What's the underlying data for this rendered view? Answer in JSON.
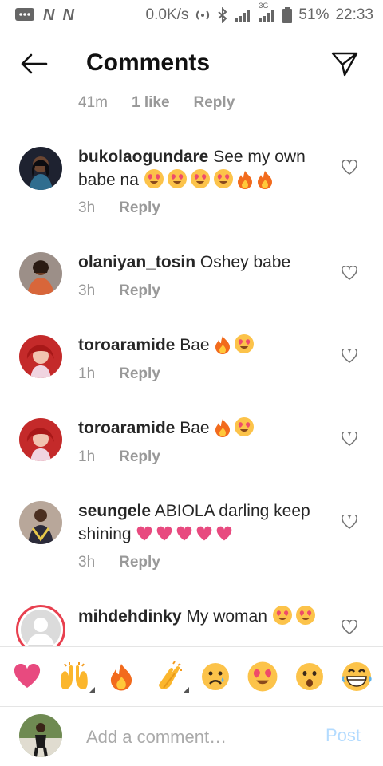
{
  "status_bar": {
    "speed": "0.0K/s",
    "network": "3G",
    "battery": "51%",
    "time": "22:33"
  },
  "header": {
    "title": "Comments"
  },
  "previous_comment_meta": {
    "time": "41m",
    "likes": "1 like",
    "reply_label": "Reply"
  },
  "comments": [
    {
      "username": "bukolaogundare",
      "text": "See my own babe na",
      "time": "3h",
      "reply_label": "Reply",
      "emojis": [
        "heart-eyes",
        "heart-eyes",
        "heart-eyes",
        "heart-eyes",
        "fire",
        "fire"
      ]
    },
    {
      "username": "olaniyan_tosin",
      "text": "Oshey babe",
      "time": "3h",
      "reply_label": "Reply",
      "emojis": []
    },
    {
      "username": "toroaramide",
      "text": "Bae",
      "time": "1h",
      "reply_label": "Reply",
      "emojis": [
        "fire",
        "heart-eyes"
      ]
    },
    {
      "username": "toroaramide",
      "text": "Bae",
      "time": "1h",
      "reply_label": "Reply",
      "emojis": [
        "fire",
        "heart-eyes"
      ]
    },
    {
      "username": "seungele",
      "text": "ABIOLA darling keep shining",
      "time": "3h",
      "reply_label": "Reply",
      "emojis": [
        "heart",
        "heart",
        "heart",
        "heart",
        "heart"
      ]
    },
    {
      "username": "mihdehdinky",
      "text": "My woman",
      "time": "",
      "reply_label": "",
      "emojis": [
        "heart-eyes",
        "heart-eyes"
      ]
    }
  ],
  "emoji_bar": [
    "red-heart",
    "raised-hands",
    "fire",
    "clapping-hands",
    "crying-face",
    "heart-eyes",
    "surprised-face",
    "grinning-face"
  ],
  "composer": {
    "placeholder": "Add a comment…",
    "post_label": "Post"
  },
  "colors": {
    "accent_post": "#b3dbff",
    "heart": "#e84a7f",
    "muted": "#999999"
  }
}
